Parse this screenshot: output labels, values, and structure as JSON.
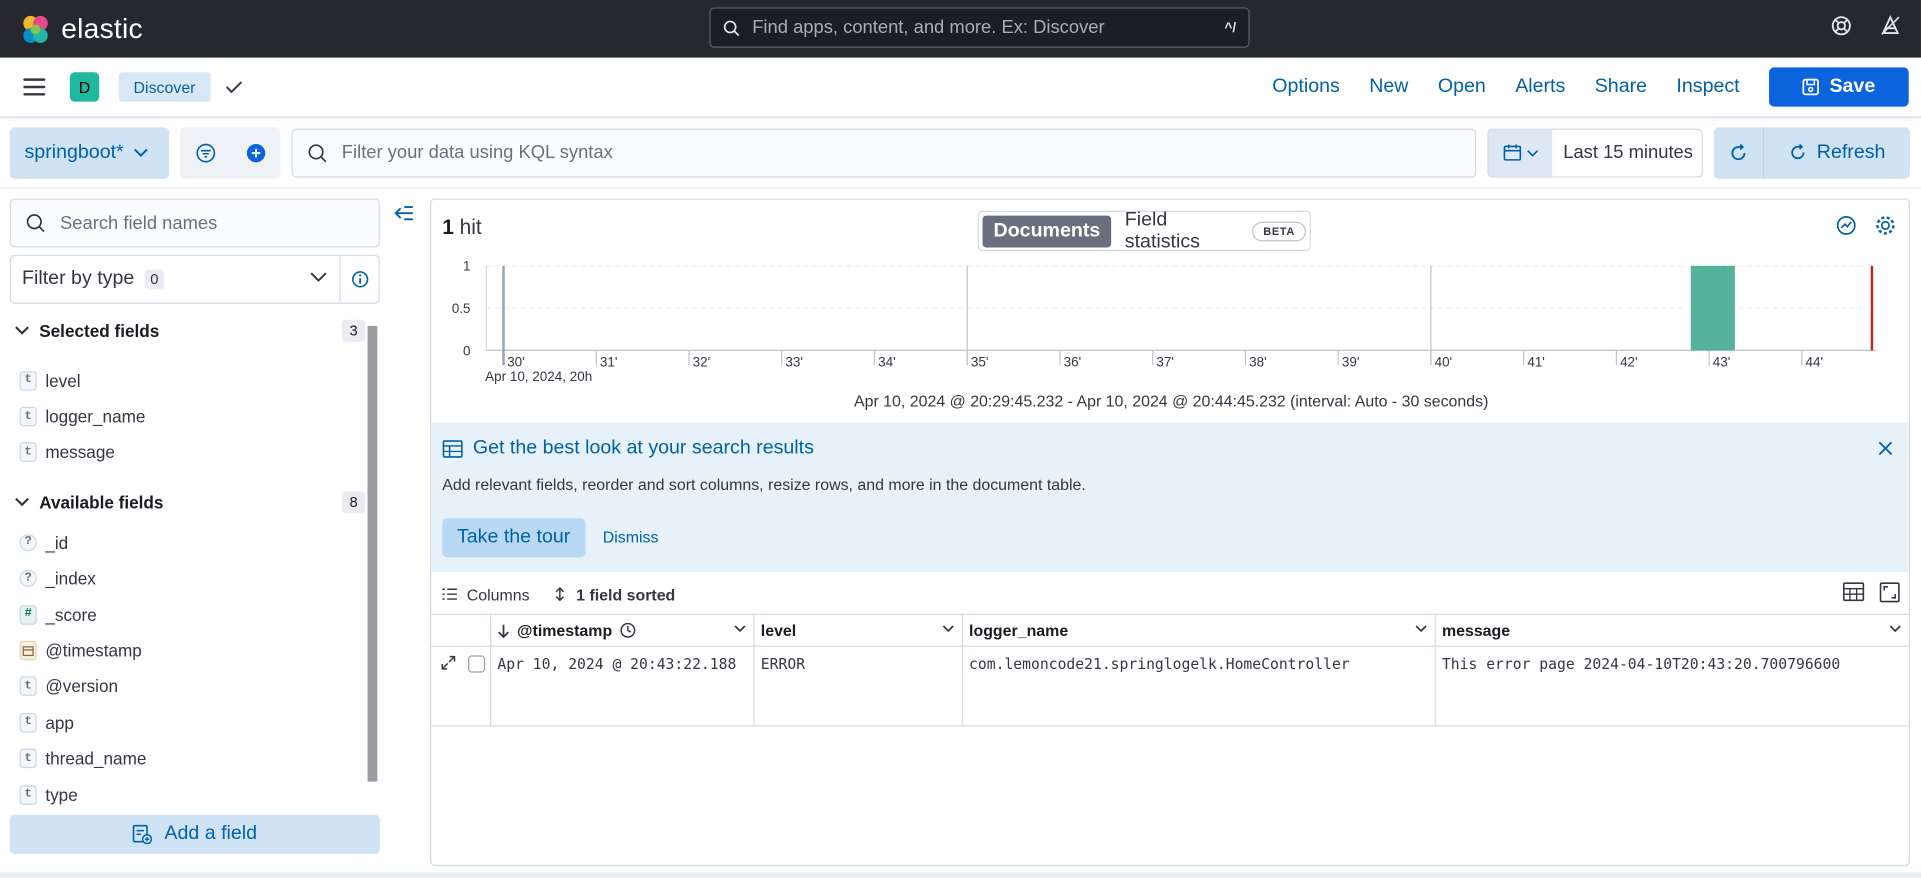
{
  "app": {
    "logo_text": "elastic",
    "global_search_placeholder": "Find apps, content, and more. Ex: Discover",
    "global_search_shortcut": "^/"
  },
  "header": {
    "space_initial": "D",
    "breadcrumb": "Discover",
    "nav": [
      "Options",
      "New",
      "Open",
      "Alerts",
      "Share",
      "Inspect"
    ],
    "save_label": "Save"
  },
  "querybar": {
    "data_view": "springboot*",
    "kql_placeholder": "Filter your data using KQL syntax",
    "time_label": "Last 15 minutes",
    "refresh_label": "Refresh"
  },
  "sidebar": {
    "search_placeholder": "Search field names",
    "filter_by_type": "Filter by type",
    "filter_count": "0",
    "selected_title": "Selected fields",
    "selected_count": "3",
    "selected_fields": [
      {
        "type": "t",
        "name": "level"
      },
      {
        "type": "t",
        "name": "logger_name"
      },
      {
        "type": "t",
        "name": "message"
      }
    ],
    "available_title": "Available fields",
    "available_count": "8",
    "available_fields": [
      {
        "type": "?",
        "name": "_id"
      },
      {
        "type": "?",
        "name": "_index"
      },
      {
        "type": "#",
        "name": "_score"
      },
      {
        "type": "date",
        "name": "@timestamp"
      },
      {
        "type": "t",
        "name": "@version"
      },
      {
        "type": "t",
        "name": "app"
      },
      {
        "type": "t",
        "name": "thread_name"
      },
      {
        "type": "t",
        "name": "type"
      }
    ],
    "add_field_label": "Add a field"
  },
  "main": {
    "hits_count": "1",
    "hits_label": "hit",
    "tab_documents": "Documents",
    "tab_field_stats": "Field statistics",
    "beta_badge": "BETA",
    "time_range": "Apr 10, 2024 @ 20:29:45.232 - Apr 10, 2024 @ 20:44:45.232 (interval: Auto - 30 seconds)",
    "callout_title": "Get the best look at your search results",
    "callout_text": "Add relevant fields, reorder and sort columns, resize rows, and more in the document table.",
    "take_tour": "Take the tour",
    "dismiss": "Dismiss",
    "columns_label": "Columns",
    "sorted_label": "1 field sorted"
  },
  "chart_data": {
    "type": "bar",
    "x_tick_labels": [
      "30'",
      "31'",
      "32'",
      "33'",
      "34'",
      "35'",
      "36'",
      "37'",
      "38'",
      "39'",
      "40'",
      "41'",
      "42'",
      "43'",
      "44'"
    ],
    "x_date_label": "Apr 10, 2024, 20h",
    "y_tick_labels": [
      "1",
      "0.5",
      "0"
    ],
    "ylim": [
      0,
      1
    ],
    "bars": [
      {
        "x_minute": 43,
        "value": 1
      }
    ],
    "bar_color": "#54b399",
    "now_marker_color": "#bd271e"
  },
  "grid": {
    "columns": [
      "@timestamp",
      "level",
      "logger_name",
      "message"
    ],
    "rows": [
      [
        "Apr 10, 2024 @ 20:43:22.188",
        "ERROR",
        "com.lemoncode21.springlogelk.HomeController",
        "This error page 2024-04-10T20:43:20.700796600"
      ]
    ]
  }
}
